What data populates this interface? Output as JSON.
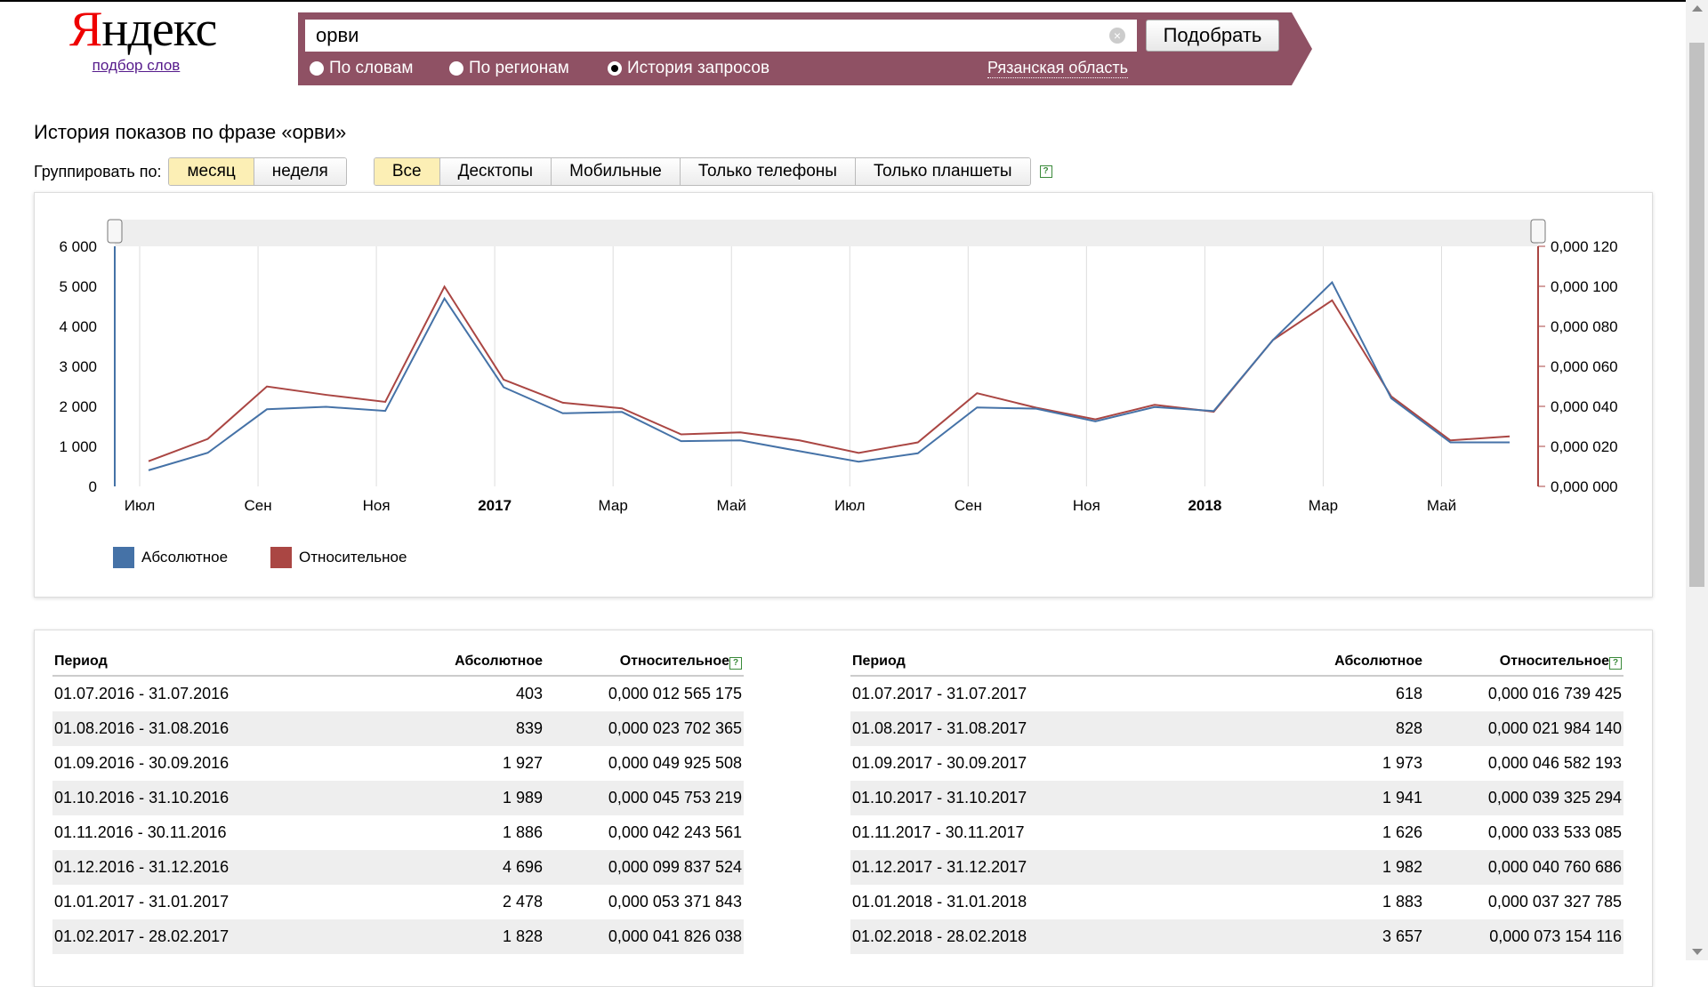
{
  "logo": {
    "text_first": "Я",
    "text_rest": "ндекс",
    "subtitle": "подбор слов"
  },
  "search": {
    "value": "орви",
    "clear_icon": "×",
    "submit_label": "Подобрать"
  },
  "radios": [
    {
      "label": "По словам",
      "checked": false
    },
    {
      "label": "По регионам",
      "checked": false
    },
    {
      "label": "История запросов",
      "checked": true
    }
  ],
  "region": "Рязанская область",
  "page_title": "История показов по фразе «орви»",
  "group_by": {
    "label": "Группировать по:",
    "options": [
      "месяц",
      "неделя"
    ],
    "active": "месяц"
  },
  "device_tabs": {
    "options": [
      "Все",
      "Десктопы",
      "Мобильные",
      "Только телефоны",
      "Только планшеты"
    ],
    "active": "Все",
    "help_icon": "?"
  },
  "chart_data": {
    "type": "line",
    "x": [
      "2016-07",
      "2016-08",
      "2016-09",
      "2016-10",
      "2016-11",
      "2016-12",
      "2017-01",
      "2017-02",
      "2017-03",
      "2017-04",
      "2017-05",
      "2017-06",
      "2017-07",
      "2017-08",
      "2017-09",
      "2017-10",
      "2017-11",
      "2017-12",
      "2018-01",
      "2018-02",
      "2018-03",
      "2018-04",
      "2018-05",
      "2018-06"
    ],
    "x_tick_labels": [
      "Июл",
      "Сен",
      "Ноя",
      "2017",
      "Мар",
      "Май",
      "Июл",
      "Сен",
      "Ноя",
      "2018",
      "Мар",
      "Май"
    ],
    "x_tick_bold": [
      "2017",
      "2018"
    ],
    "series": [
      {
        "name": "Абсолютное",
        "axis": "left",
        "color": "#4572a7",
        "values": [
          403,
          839,
          1927,
          1989,
          1886,
          4696,
          2478,
          1828,
          1860,
          1130,
          1150,
          880,
          618,
          828,
          1973,
          1941,
          1626,
          1982,
          1883,
          3657,
          5100,
          2200,
          1100,
          1100
        ]
      },
      {
        "name": "Относительное",
        "axis": "right",
        "color": "#aa4643",
        "values": [
          1.2565e-05,
          2.3702e-05,
          4.9926e-05,
          4.5753e-05,
          4.2244e-05,
          9.9838e-05,
          5.3372e-05,
          4.1826e-05,
          3.9e-05,
          2.6e-05,
          2.7e-05,
          2.3e-05,
          1.6739e-05,
          2.1984e-05,
          4.6582e-05,
          3.9325e-05,
          3.3533e-05,
          4.0761e-05,
          3.7328e-05,
          7.3154e-05,
          9.3e-05,
          4.5e-05,
          2.3e-05,
          2.5e-05
        ]
      }
    ],
    "y_left": {
      "ylim": [
        0,
        6000
      ],
      "ticks": [
        "0",
        "1 000",
        "2 000",
        "3 000",
        "4 000",
        "5 000",
        "6 000"
      ]
    },
    "y_right": {
      "ylim": [
        0,
        0.00012
      ],
      "ticks": [
        "0,000 000",
        "0,000 020",
        "0,000 040",
        "0,000 060",
        "0,000 080",
        "0,000 100",
        "0,000 120"
      ]
    },
    "grid": "vertical",
    "legend_placement": "bottom-left"
  },
  "table": {
    "headers": {
      "period": "Период",
      "absolute": "Абсолютное",
      "relative": "Относительное"
    },
    "left": [
      {
        "period": "01.07.2016 - 31.07.2016",
        "absolute": "403",
        "relative": "0,000 012 565 175"
      },
      {
        "period": "01.08.2016 - 31.08.2016",
        "absolute": "839",
        "relative": "0,000 023 702 365"
      },
      {
        "period": "01.09.2016 - 30.09.2016",
        "absolute": "1 927",
        "relative": "0,000 049 925 508"
      },
      {
        "period": "01.10.2016 - 31.10.2016",
        "absolute": "1 989",
        "relative": "0,000 045 753 219"
      },
      {
        "period": "01.11.2016 - 30.11.2016",
        "absolute": "1 886",
        "relative": "0,000 042 243 561"
      },
      {
        "period": "01.12.2016 - 31.12.2016",
        "absolute": "4 696",
        "relative": "0,000 099 837 524"
      },
      {
        "period": "01.01.2017 - 31.01.2017",
        "absolute": "2 478",
        "relative": "0,000 053 371 843"
      },
      {
        "period": "01.02.2017 - 28.02.2017",
        "absolute": "1 828",
        "relative": "0,000 041 826 038"
      }
    ],
    "right": [
      {
        "period": "01.07.2017 - 31.07.2017",
        "absolute": "618",
        "relative": "0,000 016 739 425"
      },
      {
        "period": "01.08.2017 - 31.08.2017",
        "absolute": "828",
        "relative": "0,000 021 984 140"
      },
      {
        "period": "01.09.2017 - 30.09.2017",
        "absolute": "1 973",
        "relative": "0,000 046 582 193"
      },
      {
        "period": "01.10.2017 - 31.10.2017",
        "absolute": "1 941",
        "relative": "0,000 039 325 294"
      },
      {
        "period": "01.11.2017 - 30.11.2017",
        "absolute": "1 626",
        "relative": "0,000 033 533 085"
      },
      {
        "period": "01.12.2017 - 31.12.2017",
        "absolute": "1 982",
        "relative": "0,000 040 760 686"
      },
      {
        "period": "01.01.2018 - 31.01.2018",
        "absolute": "1 883",
        "relative": "0,000 037 327 785"
      },
      {
        "period": "01.02.2018 - 28.02.2018",
        "absolute": "3 657",
        "relative": "0,000 073 154 116"
      }
    ]
  },
  "colors": {
    "searchbar": "#8f5164",
    "active_tab": "#fcefb5",
    "help": "#3a8a3a"
  }
}
